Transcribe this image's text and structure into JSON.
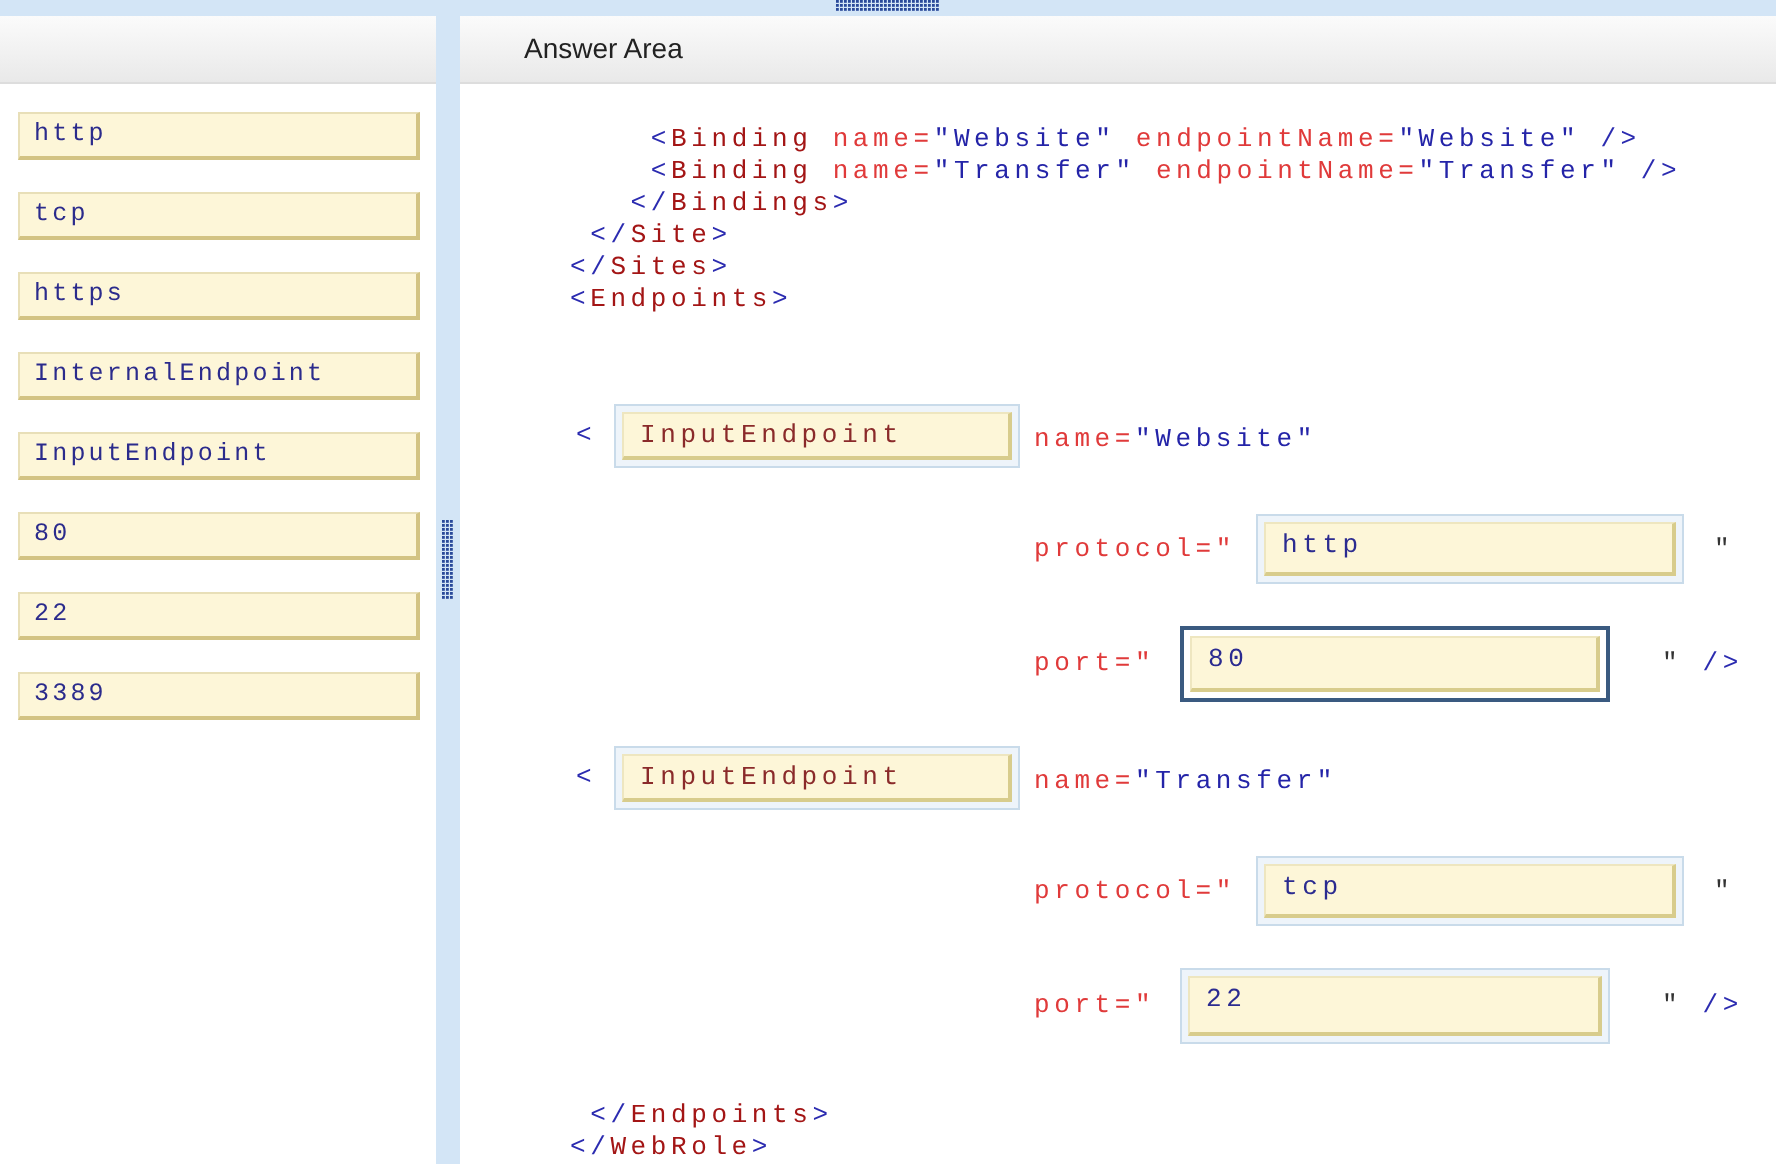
{
  "choices": [
    {
      "label": "http"
    },
    {
      "label": "tcp"
    },
    {
      "label": "https"
    },
    {
      "label": "InternalEndpoint"
    },
    {
      "label": "InputEndpoint"
    },
    {
      "label": "80"
    },
    {
      "label": "22"
    },
    {
      "label": "3389"
    }
  ],
  "answer_area": {
    "title": "Answer Area",
    "code_before": [
      {
        "tokens": [
          {
            "kind": "punct",
            "text": "    <"
          },
          {
            "kind": "tag",
            "text": "Binding"
          },
          {
            "kind": "attr",
            "text": " name="
          },
          {
            "kind": "value",
            "text": "\"Website\""
          },
          {
            "kind": "attr",
            "text": " endpointName="
          },
          {
            "kind": "value",
            "text": "\"Website\""
          },
          {
            "kind": "punct",
            "text": " />"
          }
        ]
      },
      {
        "tokens": [
          {
            "kind": "punct",
            "text": "    <"
          },
          {
            "kind": "tag",
            "text": "Binding"
          },
          {
            "kind": "attr",
            "text": " name="
          },
          {
            "kind": "value",
            "text": "\"Transfer\""
          },
          {
            "kind": "attr",
            "text": " endpointName="
          },
          {
            "kind": "value",
            "text": "\"Transfer\""
          },
          {
            "kind": "punct",
            "text": " />"
          }
        ]
      },
      {
        "tokens": [
          {
            "kind": "punct",
            "text": "   </"
          },
          {
            "kind": "tag",
            "text": "Bindings"
          },
          {
            "kind": "punct",
            "text": ">"
          }
        ]
      },
      {
        "tokens": [
          {
            "kind": "punct",
            "text": " </"
          },
          {
            "kind": "tag",
            "text": "Site"
          },
          {
            "kind": "punct",
            "text": ">"
          }
        ]
      },
      {
        "tokens": [
          {
            "kind": "punct",
            "text": "</"
          },
          {
            "kind": "tag",
            "text": "Sites"
          },
          {
            "kind": "punct",
            "text": ">"
          }
        ]
      },
      {
        "tokens": [
          {
            "kind": "punct",
            "text": "<"
          },
          {
            "kind": "tag",
            "text": "Endpoints"
          },
          {
            "kind": "punct",
            "text": ">"
          }
        ]
      }
    ],
    "endpoints": [
      {
        "open": "<",
        "element_slot": {
          "value": "InputEndpoint",
          "selected": false
        },
        "name_attr": "name=",
        "name_value": "\"Website\"",
        "protocol_label": "protocol=\"",
        "protocol_slot": {
          "value": "http",
          "selected": false
        },
        "protocol_close": "\"",
        "port_label": "port=\"",
        "port_slot": {
          "value": "80",
          "selected": true
        },
        "port_close_quote": "\"",
        "port_close": "/>"
      },
      {
        "open": "<",
        "element_slot": {
          "value": "InputEndpoint",
          "selected": false
        },
        "name_attr": "name=",
        "name_value": "\"Transfer\"",
        "protocol_label": "protocol=\"",
        "protocol_slot": {
          "value": "tcp",
          "selected": false
        },
        "protocol_close": "\"",
        "port_label": "port=\"",
        "port_slot": {
          "value": "22",
          "selected": false
        },
        "port_close_quote": "\"",
        "port_close": "/>"
      }
    ],
    "code_after": [
      {
        "tokens": [
          {
            "kind": "punct",
            "text": " </"
          },
          {
            "kind": "tag",
            "text": "Endpoints"
          },
          {
            "kind": "punct",
            "text": ">"
          }
        ]
      },
      {
        "tokens": [
          {
            "kind": "punct",
            "text": "</"
          },
          {
            "kind": "tag",
            "text": "WebRole"
          },
          {
            "kind": "punct",
            "text": ">"
          }
        ]
      }
    ]
  }
}
